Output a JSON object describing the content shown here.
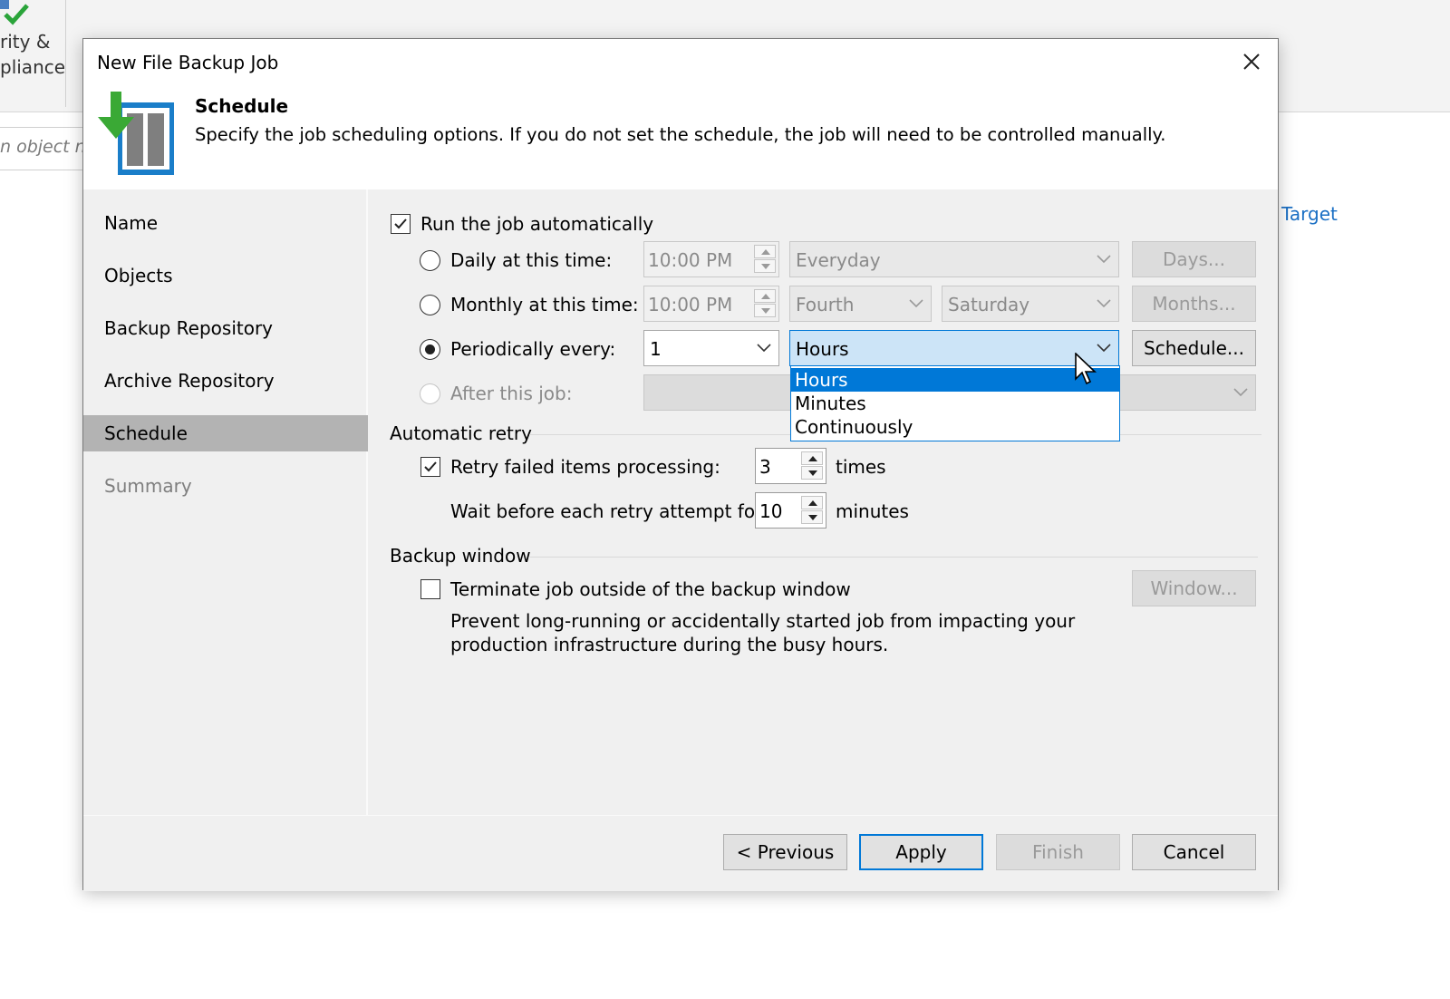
{
  "background": {
    "ribbon_text_line1": "rity &",
    "ribbon_text_line2": "pliance",
    "search_placeholder": "n object n",
    "link_text": "Target"
  },
  "dialog": {
    "title": "New File Backup Job",
    "header": {
      "title": "Schedule",
      "description": "Specify the job scheduling options. If you do not set the schedule, the job will need to be controlled manually."
    },
    "nav": [
      {
        "label": "Name",
        "state": "normal"
      },
      {
        "label": "Objects",
        "state": "normal"
      },
      {
        "label": "Backup Repository",
        "state": "normal"
      },
      {
        "label": "Archive Repository",
        "state": "normal"
      },
      {
        "label": "Schedule",
        "state": "active"
      },
      {
        "label": "Summary",
        "state": "disabled"
      }
    ],
    "schedule": {
      "run_automatically_label": "Run the job automatically",
      "run_automatically_checked": true,
      "daily_label": "Daily at this time:",
      "daily_time": "10:00 PM",
      "daily_days": "Everyday",
      "days_button": "Days...",
      "monthly_label": "Monthly at this time:",
      "monthly_time": "10:00 PM",
      "monthly_week": "Fourth",
      "monthly_day": "Saturday",
      "months_button": "Months...",
      "periodically_label": "Periodically every:",
      "periodically_value": "1",
      "periodically_unit": "Hours",
      "schedule_button": "Schedule...",
      "after_job_label": "After this job:",
      "selected_option": "periodically"
    },
    "unit_dropdown": {
      "options": [
        "Hours",
        "Minutes",
        "Continuously"
      ],
      "highlighted": "Hours"
    },
    "retry": {
      "group_label": "Automatic retry",
      "retry_label": "Retry failed items processing:",
      "retry_checked": true,
      "retry_count": "3",
      "retry_unit": "times",
      "wait_label": "Wait before each retry attempt for:",
      "wait_value": "10",
      "wait_unit": "minutes"
    },
    "window": {
      "group_label": "Backup window",
      "terminate_label": "Terminate job outside of the backup window",
      "terminate_checked": false,
      "window_button": "Window...",
      "description_line1": "Prevent long-running or accidentally started job from impacting your",
      "description_line2": "production infrastructure during the busy hours."
    },
    "footer": {
      "previous": "< Previous",
      "apply": "Apply",
      "finish": "Finish",
      "cancel": "Cancel"
    }
  },
  "colors": {
    "accent": "#0078d7",
    "nav_active": "#b3b3b3",
    "link": "#1a6fc4",
    "icon_green": "#3aa935"
  }
}
